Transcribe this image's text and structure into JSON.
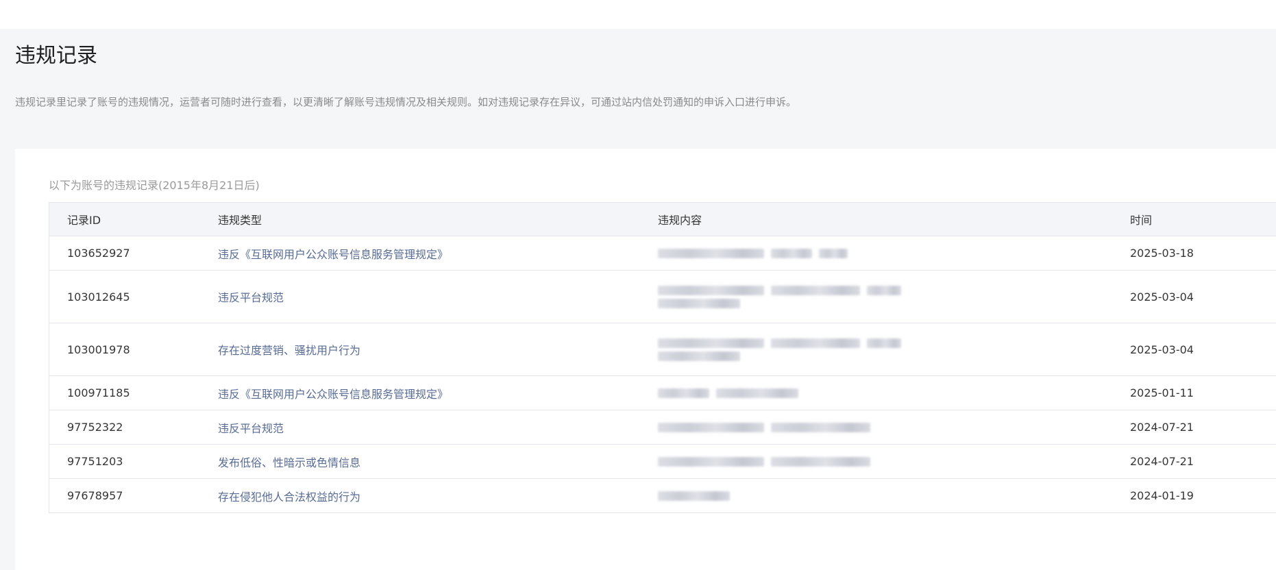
{
  "page": {
    "title": "违规记录",
    "description": "违规记录里记录了账号的违规情况，运营者可随时进行查看，以更清晰了解账号违规情况及相关规则。如对违规记录存在异议，可通过站内信处罚通知的申诉入口进行申诉。"
  },
  "records": {
    "caption": "以下为账号的违规记录(2015年8月21日后)",
    "columns": {
      "id": "记录ID",
      "type": "违规类型",
      "content": "违规内容",
      "time": "时间"
    },
    "rows": [
      {
        "id": "103652927",
        "type": "违反《互联网用户公众账号信息服务管理规定》",
        "time": "2025-03-18"
      },
      {
        "id": "103012645",
        "type": "违反平台规范",
        "time": "2025-03-04"
      },
      {
        "id": "103001978",
        "type": "存在过度营销、骚扰用户行为",
        "time": "2025-03-04"
      },
      {
        "id": "100971185",
        "type": "违反《互联网用户公众账号信息服务管理规定》",
        "time": "2025-01-11"
      },
      {
        "id": "97752322",
        "type": "违反平台规范",
        "time": "2024-07-21"
      },
      {
        "id": "97751203",
        "type": "发布低俗、性暗示或色情信息",
        "time": "2024-07-21"
      },
      {
        "id": "97678957",
        "type": "存在侵犯他人合法权益的行为",
        "time": "2024-01-19"
      }
    ]
  },
  "colors": {
    "link": "#576b95",
    "page_bg": "#f5f6f8",
    "header_bg": "#f4f5f9",
    "border": "#e4e6eb"
  }
}
